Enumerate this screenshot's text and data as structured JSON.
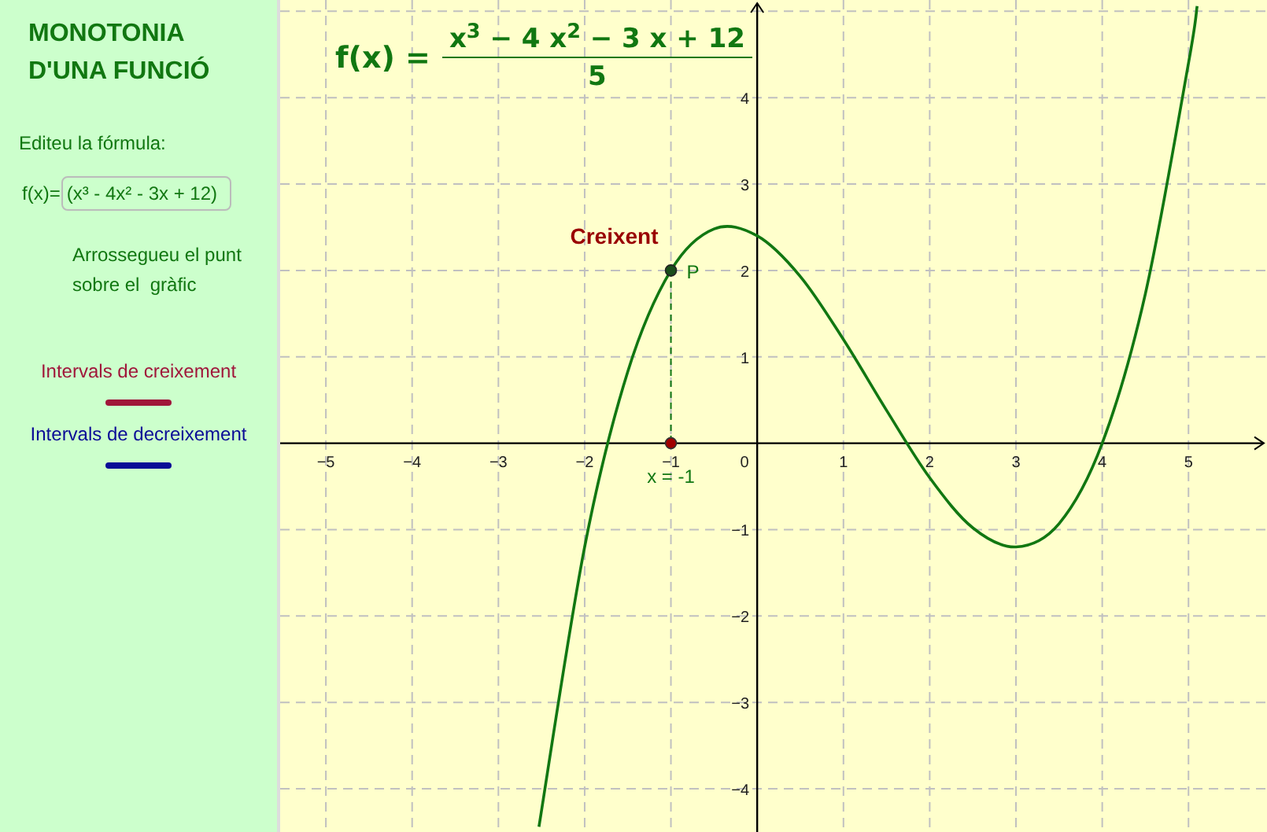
{
  "sidebar": {
    "title_lines": [
      "MONOTONIA",
      "D'UNA FUNCIÓ"
    ],
    "edit_label": "Editeu la fórmula:",
    "input": {
      "label": "f(x)=",
      "value": "(x³ - 4x² - 3x + 12)"
    },
    "instruction_lines": [
      "Arrossegueu el punt",
      "sobre el  gràfic"
    ],
    "legend": [
      {
        "label": "Intervals de creixement",
        "color": "#a0163a"
      },
      {
        "label": "Intervals de decreixement",
        "color": "#0a0a96"
      }
    ]
  },
  "graph": {
    "formula": {
      "lhs": "f(x) =",
      "numerator": "x$^{3}$ − 4 x$^{2}$ − 3 x + 12",
      "denominator": "5"
    },
    "status": "Creixent",
    "x_label": "x = -1",
    "origin_label": "0",
    "chart_data": {
      "type": "line",
      "x": [
        -2.53,
        -2,
        -1.5,
        -1,
        -0.5,
        0,
        0.5,
        1,
        1.5,
        2,
        2.5,
        3,
        3.5,
        4,
        4.5,
        5,
        5.1
      ],
      "series": [
        {
          "color": "#117711",
          "values": [
            -4.44,
            -1.2,
            0.83,
            2,
            2.48,
            2.4,
            1.93,
            1.2,
            0.38,
            -0.4,
            -0.98,
            -1.2,
            -0.93,
            0,
            1.73,
            4.4,
            5.06
          ]
        }
      ],
      "grid": true,
      "xlim": [
        -5.53,
        5.91
      ],
      "ylim": [
        -4.5,
        5.13
      ],
      "xticks": [
        {
          "value": -5,
          "label": "−5"
        },
        {
          "value": -4,
          "label": "−4"
        },
        {
          "value": -3,
          "label": "−3"
        },
        {
          "value": -2,
          "label": "−2"
        },
        {
          "value": -1,
          "label": "−1"
        },
        {
          "value": 1,
          "label": "1"
        },
        {
          "value": 2,
          "label": "2"
        },
        {
          "value": 3,
          "label": "3"
        },
        {
          "value": 4,
          "label": "4"
        },
        {
          "value": 5,
          "label": "5"
        }
      ],
      "yticks": [
        {
          "value": -4,
          "label": "−4"
        },
        {
          "value": -3,
          "label": "−3"
        },
        {
          "value": -2,
          "label": "−2"
        },
        {
          "value": -1,
          "label": "−1"
        },
        {
          "value": 1,
          "label": "1"
        },
        {
          "value": 2,
          "label": "2"
        },
        {
          "value": 3,
          "label": "3"
        },
        {
          "value": 4,
          "label": "4"
        }
      ],
      "annotations": [
        {
          "x": -1,
          "y": 2,
          "text": "P"
        }
      ]
    }
  }
}
